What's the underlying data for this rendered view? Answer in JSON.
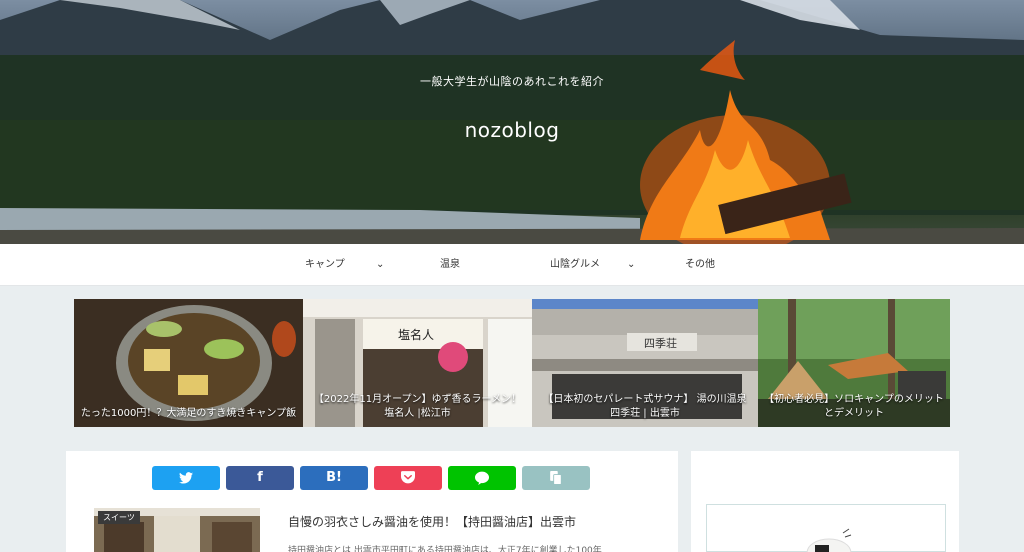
{
  "site": {
    "subtitle": "一般大学生が山陰のあれこれを紹介",
    "title": "nozoblog"
  },
  "nav": {
    "items": [
      {
        "label": "キャンプ",
        "has_dropdown": true
      },
      {
        "label": "温泉",
        "has_dropdown": false
      },
      {
        "label": "山陰グルメ",
        "has_dropdown": true
      },
      {
        "label": "その他",
        "has_dropdown": false
      }
    ],
    "chevron": "⌄"
  },
  "featured": [
    {
      "caption": "たった1000円！？大満足のすき焼きキャンプ飯"
    },
    {
      "caption": "【2022年11月オープン】ゆず香るラーメン！塩名人 |松江市"
    },
    {
      "caption": "【日本初のセパレート式サウナ】 湯の川温泉 四季荘 | 出雲市"
    },
    {
      "caption": "【初心者必見】ソロキャンプのメリットとデメリット"
    }
  ],
  "share_buttons": [
    {
      "name": "twitter",
      "label": "",
      "icon": "twitter-bird-icon",
      "color": "#1da1f2"
    },
    {
      "name": "facebook",
      "label": "f",
      "icon": "facebook-icon",
      "color": "#3b5998"
    },
    {
      "name": "hatena",
      "label": "B!",
      "icon": "hatena-bookmark-icon",
      "color": "#2c6ebd"
    },
    {
      "name": "pocket",
      "label": "",
      "icon": "pocket-icon",
      "color": "#ee4056"
    },
    {
      "name": "line",
      "label": "",
      "icon": "line-icon",
      "color": "#00c300"
    },
    {
      "name": "copy",
      "label": "",
      "icon": "copy-icon",
      "color": "#99c2c2"
    }
  ],
  "post": {
    "category": "スイーツ",
    "title": "自慢の羽衣さしみ醤油を使用！【持田醤油店】出雲市",
    "excerpt": "持田醤油店とは 出雲市平田町にある持田醤油店は、大正7年に創業した100年"
  }
}
